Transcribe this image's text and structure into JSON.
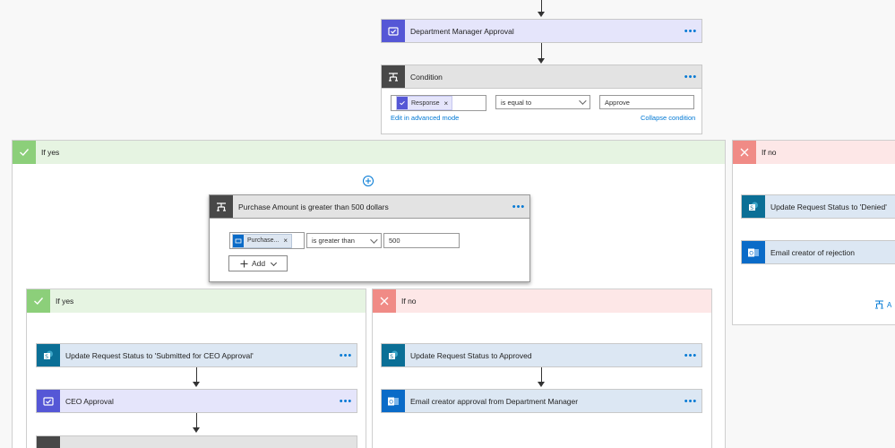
{
  "top": {
    "dm_approval": "Department Manager Approval",
    "condition": {
      "title": "Condition",
      "token": "Response",
      "operator": "is equal to",
      "value": "Approve",
      "edit_advanced": "Edit in advanced mode",
      "collapse": "Collapse condition"
    }
  },
  "outer_yes": {
    "label": "If yes",
    "nested_condition": {
      "title": "Purchase Amount is greater than 500 dollars",
      "token": "Purchase...",
      "operator": "is greater than",
      "value": "500",
      "add_label": "Add"
    },
    "inner_yes": {
      "label": "If yes",
      "actions": [
        "Update Request Status to 'Submitted for CEO Approval'",
        "CEO Approval"
      ]
    },
    "inner_no": {
      "label": "If no",
      "actions": [
        "Update Request Status to Approved",
        "Email creator approval from Department Manager"
      ]
    }
  },
  "outer_no": {
    "label": "If no",
    "actions": [
      "Update Request Status to 'Denied'",
      "Email creator of rejection"
    ],
    "add_partial": "A"
  },
  "more_label": "•••",
  "colors": {
    "approval": "#5557d6",
    "sharepoint": "#0b6f96",
    "outlook": "#0a6bc8",
    "condition": "#484848",
    "yes": "#8ccf7a",
    "no": "#f08b86",
    "link": "#0078d4"
  },
  "icons": [
    "approval-icon",
    "condition-icon",
    "sharepoint-icon",
    "outlook-icon",
    "check-icon",
    "close-icon",
    "plus-icon"
  ]
}
